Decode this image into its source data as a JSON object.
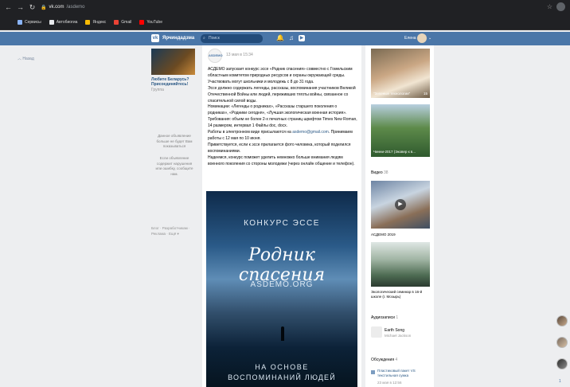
{
  "browser": {
    "url_domain": "vk.com",
    "url_path": "/asdemo",
    "bookmarks": [
      {
        "label": "Сервисы",
        "color": "#8ab4f8"
      },
      {
        "label": "Автобиогиа",
        "color": "#e8eaed"
      },
      {
        "label": "Яндекс",
        "color": "#fbbc04"
      },
      {
        "label": "Gmail",
        "color": "#ea4335"
      },
      {
        "label": "YouTube",
        "color": "#ff0000"
      }
    ]
  },
  "vk_header": {
    "logo": "vk",
    "site_name": "Ярчиндадзма",
    "search_placeholder": "Поиск",
    "user_name": "Елена",
    "accent": "#4a76a8"
  },
  "left": {
    "back_label": "Назад",
    "promo_title": "Любите Беларусь? Присоединяйтесь!",
    "promo_sub": "Группа",
    "ad_note": "Данное объявление больше не будет Вам показываться",
    "ad_note2": "Если объявление содержит нарушения или ошибку, сообщите нам.",
    "footer_links": "Блог · Разработчикам · Реклама · Ещё ▾"
  },
  "post": {
    "author_avatar_text": "ASDEMO",
    "date": "13 мая в 15:34",
    "paragraphs": [
      "АСДЕМО запускает конкурс эссе «Родник спасения» совместно с Гомельским областным комитетом природных ресурсов и охраны окружающей среды.",
      "Участвовать могут школьники и молодежь с 8 до 31 года.",
      "Эссе должно содержать легенды, рассказы, воспоминания участников Великой Отечественной Войны или людей, переживших тяготы войны, связанное со спасительной силой воды.",
      "Номинации: «Легенды о родниках», «Рассказы старшего поколения о родниках», «Родники сегодня», «Лучшая экологическая военная история».",
      "Требования: объем не более 2-х печатных страниц шрифтом Times New Roman, 14 размером, интервал 1 Файлы doc, docx.",
      "Работы в электронном виде присылаются на",
      "asdemo@gmail.com",
      ". Принимаем работы с 12 мая по 10 июня.",
      "Приветствуется, если к эссе прилагается фото человека, который поделился воспоминаниями.",
      "Надеемся, конкурс поможет уделить немножко больше внимания людям военного поколения со стороны молодежи (через онлайн общение и телефон)."
    ],
    "poster": {
      "line1": "КОНКУРС ЭССЕ",
      "line2": "Родник спасения",
      "line3": "ASDEMO.ORG",
      "line4": "НА ОСНОВЕ",
      "line5": "ВОСПОМИНАНИЙ ЛЮДЕЙ"
    }
  },
  "right": {
    "photo1_caption": "\"Зеленые технологии\"",
    "photo1_count": "15",
    "photo2_caption": "Чинни-2017 (Эковер к в...",
    "videos_label": "Видео",
    "videos_count": "38",
    "video1_caption": "АСДЕМО 2019",
    "video2_caption": "Экологический семинар в 16-й школе (г. Мозырь)",
    "audio_label": "Аудиозаписи",
    "audio_count": "1",
    "audio_title": "Earth Song",
    "audio_artist": "Michael Jackson",
    "discussions_label": "Обсуждения",
    "discussions_count": "4",
    "discussion_title": "Пластиковый пакет VS текстильная сумка",
    "discussion_sub": "23 мая в 12:56"
  },
  "chat": {
    "count": "1"
  }
}
